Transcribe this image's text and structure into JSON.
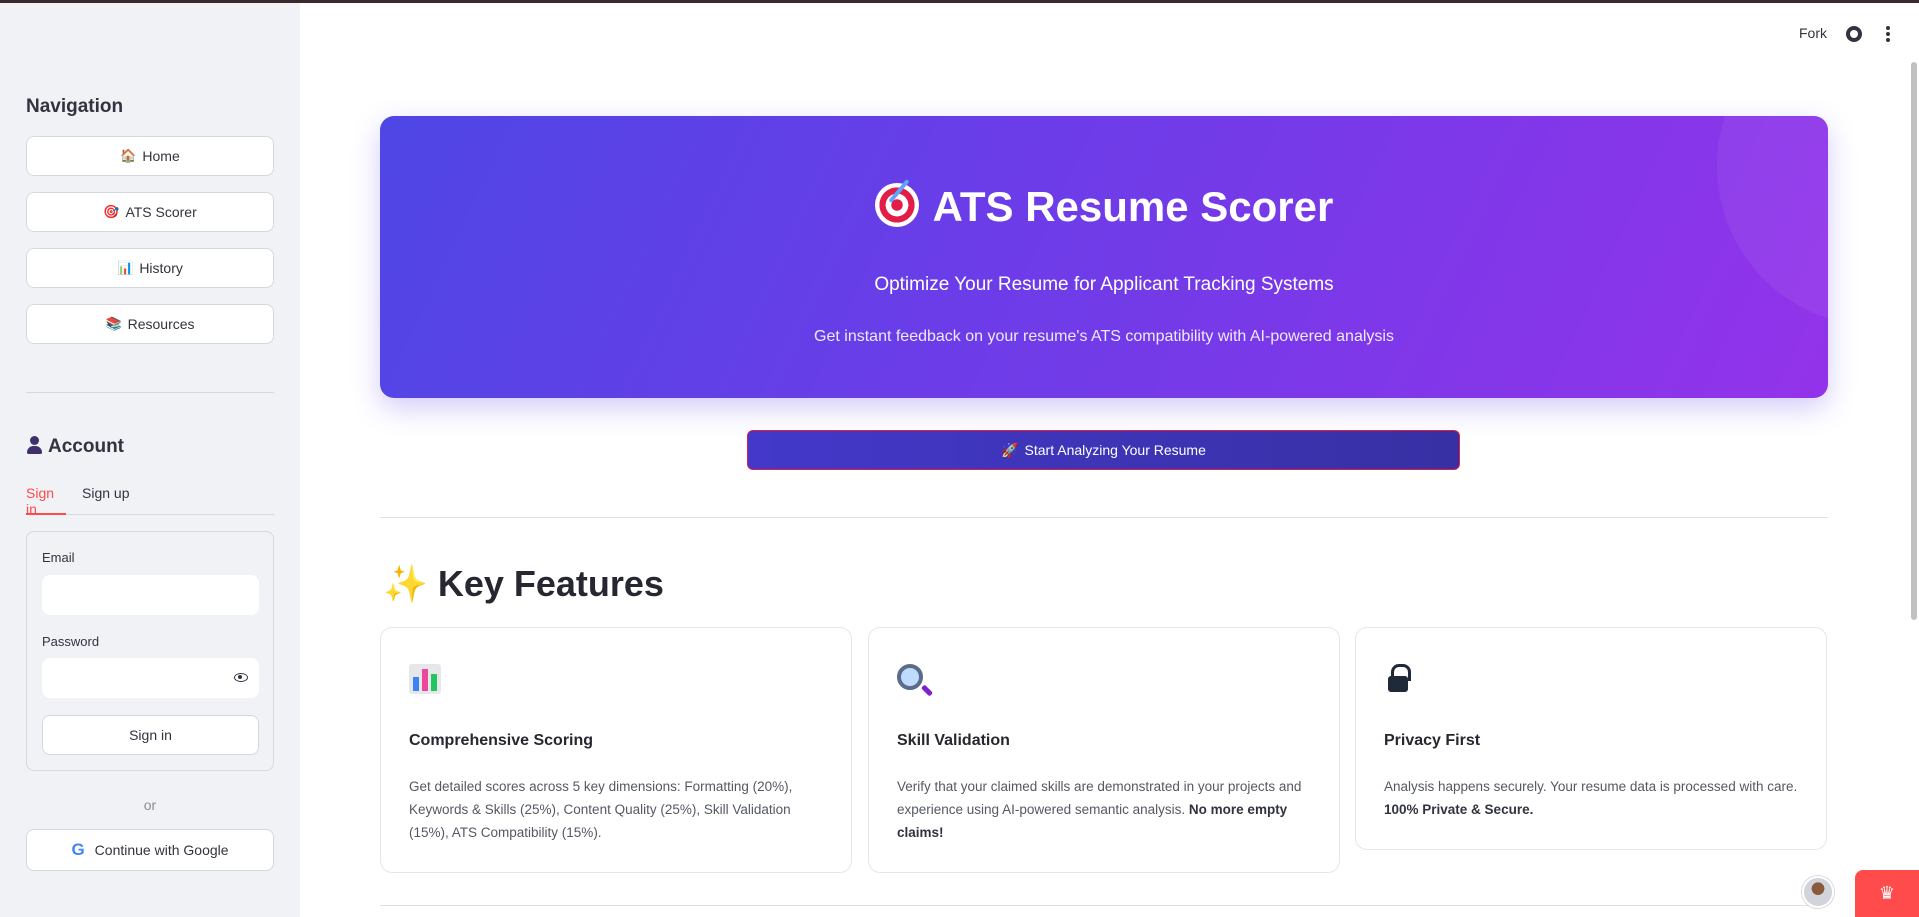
{
  "sidebar": {
    "navigation_heading": "Navigation",
    "nav_items": [
      {
        "icon": "house-icon",
        "glyph": "🏠",
        "label": "Home"
      },
      {
        "icon": "target-icon",
        "glyph": "🎯",
        "label": "ATS Scorer"
      },
      {
        "icon": "chart-icon",
        "glyph": "📊",
        "label": "History"
      },
      {
        "icon": "books-icon",
        "glyph": "📚",
        "label": "Resources"
      }
    ],
    "account_heading": "Account",
    "tabs": [
      {
        "label": "Sign in",
        "active": true
      },
      {
        "label": "Sign up",
        "active": false
      }
    ],
    "form": {
      "email_label": "Email",
      "email_value": "",
      "password_label": "Password",
      "password_value": "",
      "submit_label": "Sign in"
    },
    "or_text": "or",
    "google_label": "Continue with Google",
    "google_glyph": "G"
  },
  "topbar": {
    "fork_label": "Fork"
  },
  "hero": {
    "title": "ATS Resume Scorer",
    "subtitle": "Optimize Your Resume for Applicant Tracking Systems",
    "description": "Get instant feedback on your resume's ATS compatibility with AI-powered analysis",
    "gradient_start": "#4f46e5",
    "gradient_end": "#9333ea"
  },
  "cta": {
    "glyph": "🚀",
    "label": "Start Analyzing Your Resume"
  },
  "features": {
    "glyph": "✨",
    "heading": "Key Features",
    "cards": [
      {
        "icon": "bar-chart-icon",
        "title": "Comprehensive Scoring",
        "description": "Get detailed scores across 5 key dimensions: Formatting (20%), Keywords & Skills (25%), Content Quality (25%), Skill Validation (15%), ATS Compatibility (15%).",
        "emphasis": ""
      },
      {
        "icon": "magnifier-icon",
        "title": "Skill Validation",
        "description": "Verify that your claimed skills are demonstrated in your projects and experience using AI-powered semantic analysis.",
        "emphasis": "No more empty claims!"
      },
      {
        "icon": "lock-icon",
        "title": "Privacy First",
        "description": "Analysis happens securely. Your resume data is processed with care.",
        "emphasis": "100% Private & Secure."
      }
    ]
  },
  "colors": {
    "accent": "#ff4b4b",
    "sidebar_bg": "#f0f2f6",
    "cta_bg": "#4338ca"
  }
}
